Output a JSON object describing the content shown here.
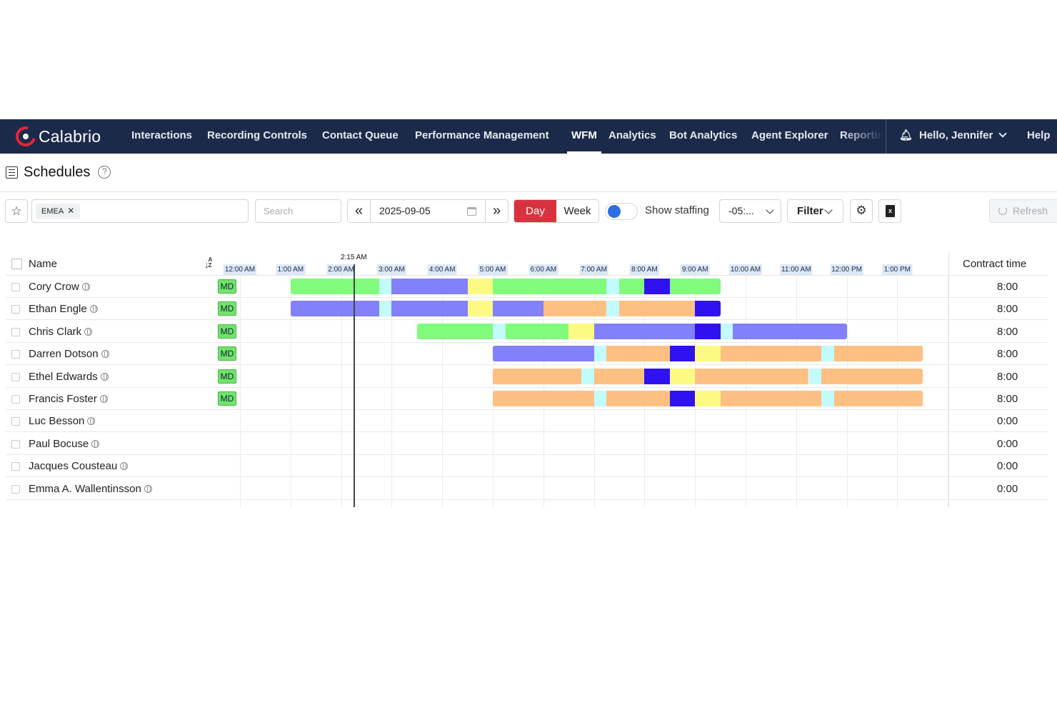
{
  "nav": {
    "brand": "Calabrio",
    "items": [
      "Interactions",
      "Recording Controls",
      "Contact Queue",
      "Performance Management",
      "WFM",
      "Analytics",
      "Bot Analytics",
      "Agent Explorer",
      "Reportin"
    ],
    "active": "WFM",
    "greeting": "Hello, Jennifer",
    "help": "Help"
  },
  "page": {
    "title": "Schedules"
  },
  "toolbar": {
    "chip": "EMEA",
    "search_placeholder": "Search",
    "date": "2025-09-05",
    "view_day": "Day",
    "view_week": "Week",
    "show_staffing": "Show staffing",
    "timezone": "-05:...",
    "filter": "Filter",
    "refresh": "Refresh"
  },
  "grid": {
    "col_name": "Name",
    "col_contract": "Contract time",
    "now_label": "2:15 AM",
    "now_hour": 2.25,
    "hours_labels": [
      "12:00 AM",
      "1:00 AM",
      "2:00 AM",
      "3:00 AM",
      "4:00 AM",
      "5:00 AM",
      "6:00 AM",
      "7:00 AM",
      "8:00 AM",
      "9:00 AM",
      "10:00 AM",
      "11:00 AM",
      "12:00 PM",
      "1:00 PM"
    ],
    "activity_colors": {
      "green": "#80fb7c",
      "purple": "#8280fa",
      "yellow": "#fdfa83",
      "orange": "#fdc082",
      "break": "#c2fbfb",
      "blue": "#2f11f1"
    },
    "rows": [
      {
        "name": "Cory Crow",
        "badge": "MD",
        "contract": "8:00",
        "segments": [
          [
            1.0,
            2.75,
            "green"
          ],
          [
            2.75,
            3.0,
            "break"
          ],
          [
            3.0,
            4.5,
            "purple"
          ],
          [
            4.5,
            5.0,
            "yellow"
          ],
          [
            5.0,
            7.25,
            "green"
          ],
          [
            7.25,
            7.5,
            "break"
          ],
          [
            7.5,
            8.0,
            "green"
          ],
          [
            8.0,
            8.5,
            "blue"
          ],
          [
            8.5,
            9.5,
            "green"
          ]
        ]
      },
      {
        "name": "Ethan Engle",
        "badge": "MD",
        "contract": "8:00",
        "segments": [
          [
            1.0,
            2.75,
            "purple"
          ],
          [
            2.75,
            3.0,
            "break"
          ],
          [
            3.0,
            4.5,
            "purple"
          ],
          [
            4.5,
            5.0,
            "yellow"
          ],
          [
            5.0,
            6.0,
            "purple"
          ],
          [
            6.0,
            7.25,
            "orange"
          ],
          [
            7.25,
            7.5,
            "break"
          ],
          [
            7.5,
            9.0,
            "orange"
          ],
          [
            9.0,
            9.5,
            "blue"
          ]
        ]
      },
      {
        "name": "Chris Clark",
        "badge": "MD",
        "contract": "8:00",
        "segments": [
          [
            3.5,
            5.0,
            "green"
          ],
          [
            5.0,
            5.25,
            "break"
          ],
          [
            5.25,
            6.5,
            "green"
          ],
          [
            6.5,
            7.0,
            "yellow"
          ],
          [
            7.0,
            9.0,
            "purple"
          ],
          [
            9.0,
            9.5,
            "blue"
          ],
          [
            9.5,
            9.75,
            "break"
          ],
          [
            9.75,
            12.0,
            "purple"
          ]
        ]
      },
      {
        "name": "Darren Dotson",
        "badge": "MD",
        "contract": "8:00",
        "segments": [
          [
            5.0,
            7.0,
            "purple"
          ],
          [
            7.0,
            7.25,
            "break"
          ],
          [
            7.25,
            8.5,
            "orange"
          ],
          [
            8.5,
            9.0,
            "blue"
          ],
          [
            9.0,
            9.5,
            "yellow"
          ],
          [
            9.5,
            11.5,
            "orange"
          ],
          [
            11.5,
            11.75,
            "break"
          ],
          [
            11.75,
            13.5,
            "orange"
          ]
        ]
      },
      {
        "name": "Ethel Edwards",
        "badge": "MD",
        "contract": "8:00",
        "segments": [
          [
            5.0,
            6.75,
            "orange"
          ],
          [
            6.75,
            7.0,
            "break"
          ],
          [
            7.0,
            8.0,
            "orange"
          ],
          [
            8.0,
            8.5,
            "blue"
          ],
          [
            8.5,
            9.0,
            "yellow"
          ],
          [
            9.0,
            11.25,
            "orange"
          ],
          [
            11.25,
            11.5,
            "break"
          ],
          [
            11.5,
            13.5,
            "orange"
          ]
        ]
      },
      {
        "name": "Francis Foster",
        "badge": "MD",
        "contract": "8:00",
        "segments": [
          [
            5.0,
            7.0,
            "orange"
          ],
          [
            7.0,
            7.25,
            "break"
          ],
          [
            7.25,
            8.5,
            "orange"
          ],
          [
            8.5,
            9.0,
            "blue"
          ],
          [
            9.0,
            9.5,
            "yellow"
          ],
          [
            9.5,
            11.5,
            "orange"
          ],
          [
            11.5,
            11.75,
            "break"
          ],
          [
            11.75,
            13.5,
            "orange"
          ]
        ]
      },
      {
        "name": "Luc Besson",
        "badge": "",
        "contract": "0:00",
        "segments": []
      },
      {
        "name": "Paul Bocuse",
        "badge": "",
        "contract": "0:00",
        "segments": []
      },
      {
        "name": "Jacques Cousteau",
        "badge": "",
        "contract": "0:00",
        "segments": []
      },
      {
        "name": "Emma A. Wallentinsson",
        "badge": "",
        "contract": "0:00",
        "segments": []
      }
    ]
  }
}
